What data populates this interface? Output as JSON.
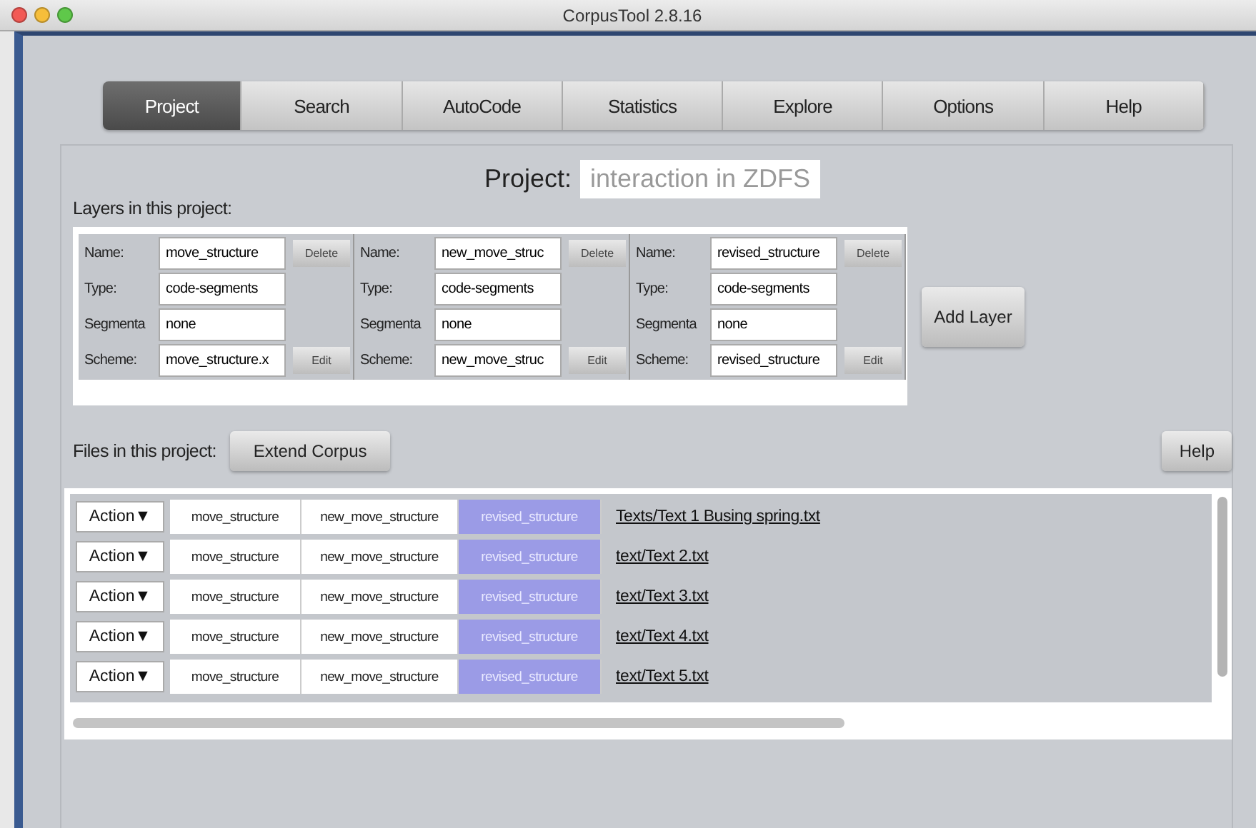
{
  "window": {
    "title": "CorpusTool 2.8.16"
  },
  "tabs": [
    {
      "label": "Project",
      "selected": true
    },
    {
      "label": "Search",
      "selected": false
    },
    {
      "label": "AutoCode",
      "selected": false
    },
    {
      "label": "Statistics",
      "selected": false
    },
    {
      "label": "Explore",
      "selected": false
    },
    {
      "label": "Options",
      "selected": false
    },
    {
      "label": "Help",
      "selected": false
    }
  ],
  "project": {
    "label": "Project:",
    "name": "interaction in ZDFS"
  },
  "layers_label": "Layers in this project:",
  "layers": [
    {
      "fields": [
        {
          "label": "Name:",
          "value": "move_structure"
        },
        {
          "label": "Type:",
          "value": "code-segments"
        },
        {
          "label": "Segmenta",
          "value": "none"
        },
        {
          "label": "Scheme:",
          "value": "move_structure.x"
        }
      ],
      "delete": "Delete",
      "edit": "Edit"
    },
    {
      "fields": [
        {
          "label": "Name:",
          "value": "new_move_struc"
        },
        {
          "label": "Type:",
          "value": "code-segments"
        },
        {
          "label": "Segmenta",
          "value": "none"
        },
        {
          "label": "Scheme:",
          "value": "new_move_struc"
        }
      ],
      "delete": "Delete",
      "edit": "Edit"
    },
    {
      "fields": [
        {
          "label": "Name:",
          "value": "revised_structure"
        },
        {
          "label": "Type:",
          "value": "code-segments"
        },
        {
          "label": "Segmenta",
          "value": "none"
        },
        {
          "label": "Scheme:",
          "value": "revised_structure"
        }
      ],
      "delete": "Delete",
      "edit": "Edit"
    }
  ],
  "add_layer": "Add Layer",
  "files_label": "Files in this project:",
  "extend_corpus": "Extend Corpus",
  "help": "Help",
  "files": [
    {
      "action": "Action▼",
      "layers": [
        {
          "label": "move_structure",
          "selected": false
        },
        {
          "label": "new_move_structure",
          "selected": false
        },
        {
          "label": "revised_structure",
          "selected": true
        }
      ],
      "path": "Texts/Text 1 Busing spring.txt"
    },
    {
      "action": "Action▼",
      "layers": [
        {
          "label": "move_structure",
          "selected": false
        },
        {
          "label": "new_move_structure",
          "selected": false
        },
        {
          "label": "revised_structure",
          "selected": true
        }
      ],
      "path": "text/Text 2.txt"
    },
    {
      "action": "Action▼",
      "layers": [
        {
          "label": "move_structure",
          "selected": false
        },
        {
          "label": "new_move_structure",
          "selected": false
        },
        {
          "label": "revised_structure",
          "selected": true
        }
      ],
      "path": "text/Text 3.txt"
    },
    {
      "action": "Action▼",
      "layers": [
        {
          "label": "move_structure",
          "selected": false
        },
        {
          "label": "new_move_structure",
          "selected": false
        },
        {
          "label": "revised_structure",
          "selected": true
        }
      ],
      "path": "text/Text 4.txt"
    },
    {
      "action": "Action▼",
      "layers": [
        {
          "label": "move_structure",
          "selected": false
        },
        {
          "label": "new_move_structure",
          "selected": false
        },
        {
          "label": "revised_structure",
          "selected": true
        }
      ],
      "path": "text/Text 5.txt"
    }
  ]
}
